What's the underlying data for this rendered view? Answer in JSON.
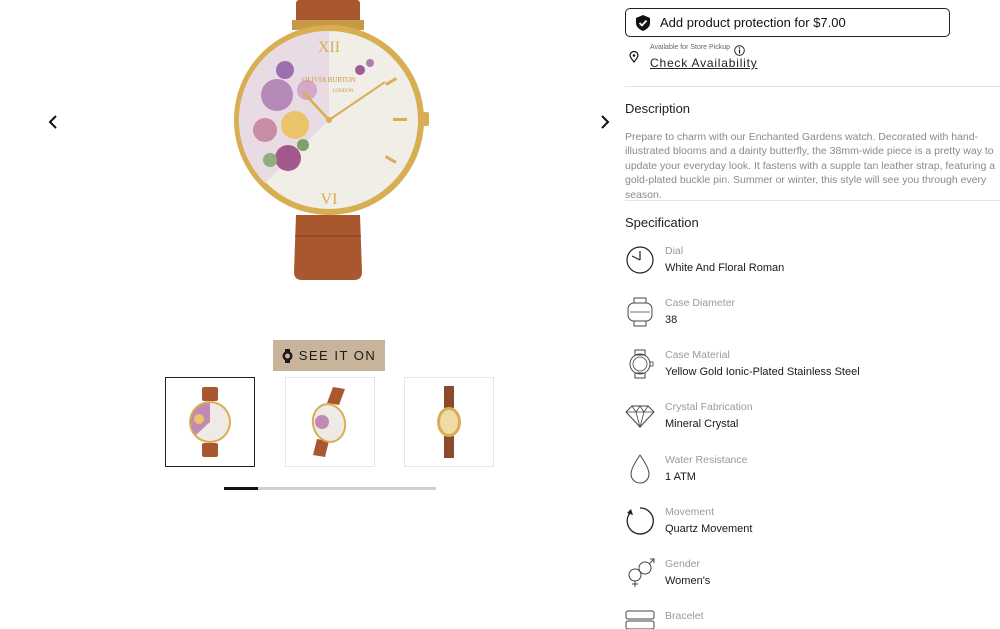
{
  "gallery": {
    "prev_icon": "chevron-left-icon",
    "next_icon": "chevron-right-icon",
    "see_it_on_label": "SEE IT ON",
    "see_it_on_icon": "watch-icon",
    "thumbnails": [
      {
        "name": "thumbnail-front-view",
        "active": true
      },
      {
        "name": "thumbnail-angled-view",
        "active": false
      },
      {
        "name": "thumbnail-side-view",
        "active": false
      }
    ],
    "dial_brand_text": "OLIVIA BURTON",
    "dial_brand_sub": "LONDON",
    "scroll_progress_fraction": 0.16
  },
  "purchase": {
    "protection_label": "Add product protection for $7.00",
    "protection_icon": "shield-check-icon",
    "store_pickup_label": "Available for Store Pickup",
    "check_availability_label": "Check Availability"
  },
  "description": {
    "title": "Description",
    "text": "Prepare to charm with our Enchanted Gardens watch. Decorated with hand-illustrated blooms and a dainty butterfly, the 38mm-wide piece is a pretty way to update your everyday look. It fastens with a supple tan leather strap, featuring a gold-plated buckle pin. Summer or winter, this style will see you through every season."
  },
  "specification": {
    "title": "Specification",
    "items": [
      {
        "label": "Dial",
        "value": "White And Floral Roman",
        "icon": "dial-icon"
      },
      {
        "label": "Case Diameter",
        "value": "38",
        "icon": "case-diameter-icon"
      },
      {
        "label": "Case Material",
        "value": "Yellow Gold Ionic-Plated Stainless Steel",
        "icon": "case-material-icon"
      },
      {
        "label": "Crystal Fabrication",
        "value": "Mineral Crystal",
        "icon": "crystal-icon"
      },
      {
        "label": "Water Resistance",
        "value": "1 ATM",
        "icon": "water-drop-icon"
      },
      {
        "label": "Movement",
        "value": "Quartz Movement",
        "icon": "movement-icon"
      },
      {
        "label": "Gender",
        "value": "Women's",
        "icon": "gender-icon"
      },
      {
        "label": "Bracelet",
        "value": "",
        "icon": "bracelet-icon"
      }
    ]
  },
  "colors": {
    "strap": "#a8572f",
    "gold": "#d8ae52",
    "see_it_on_bg": "#c8b49a",
    "description_text": "#8a8a8a"
  }
}
